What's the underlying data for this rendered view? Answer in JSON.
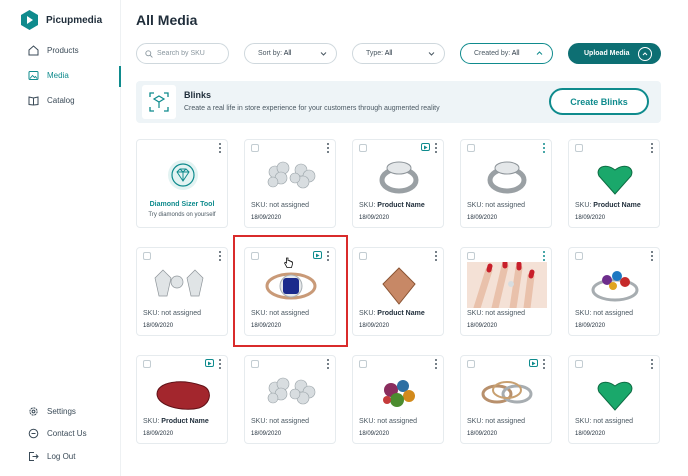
{
  "brand": {
    "name": "Picupmedia"
  },
  "sidebar": {
    "items": [
      {
        "label": "Products",
        "icon": "home-icon"
      },
      {
        "label": "Media",
        "icon": "image-icon"
      },
      {
        "label": "Catalog",
        "icon": "book-icon"
      }
    ],
    "bottom": [
      {
        "label": "Settings",
        "icon": "gear-icon"
      },
      {
        "label": "Contact Us",
        "icon": "chat-icon"
      },
      {
        "label": "Log Out",
        "icon": "logout-icon"
      }
    ]
  },
  "page": {
    "title": "All Media"
  },
  "filters": {
    "search_placeholder": "Search by SKU",
    "sort_label": "Sort by:",
    "sort_value": "All",
    "type_label": "Type:",
    "type_value": "All",
    "created_label": "Created by:",
    "created_value": "All",
    "upload_label": "Upload Media"
  },
  "blinks": {
    "title": "Blinks",
    "description": "Create a real life in store experience for your customers through augmented reality",
    "button": "Create Blinks"
  },
  "tool_card": {
    "title": "Diamond Sizer Tool",
    "subtitle": "Try diamonds on yourself"
  },
  "cards": [
    {
      "sku_label": "SKU:",
      "sku_value": "not assigned",
      "date": "18/09/2020",
      "image": "diamond-earrings",
      "video": false
    },
    {
      "sku_label": "SKU:",
      "sku_value": "Product Name",
      "date": "18/09/2020",
      "image": "silver-ring",
      "video": true
    },
    {
      "sku_label": "SKU:",
      "sku_value": "not assigned",
      "date": "18/09/2020",
      "image": "silver-ring-2",
      "video": false
    },
    {
      "sku_label": "SKU:",
      "sku_value": "Product Name",
      "date": "18/09/2020",
      "image": "green-heart-gem",
      "video": false
    },
    {
      "sku_label": "SKU:",
      "sku_value": "not assigned",
      "date": "18/09/2020",
      "image": "diamond-studs",
      "video": false
    },
    {
      "sku_label": "SKU:",
      "sku_value": "not assigned",
      "date": "18/09/2020",
      "image": "sapphire-ring",
      "video": true
    },
    {
      "sku_label": "SKU:",
      "sku_value": "Product Name",
      "date": "18/09/2020",
      "image": "morganite-gem",
      "video": false
    },
    {
      "sku_label": "SKU:",
      "sku_value": "not assigned",
      "date": "18/09/2020",
      "image": "hand-ring",
      "video": false
    },
    {
      "sku_label": "SKU:",
      "sku_value": "not assigned",
      "date": "18/09/2020",
      "image": "multi-gem-rings",
      "video": false
    },
    {
      "sku_label": "SKU:",
      "sku_value": "Product Name",
      "date": "18/09/2020",
      "image": "red-pear-gem",
      "video": true
    },
    {
      "sku_label": "SKU:",
      "sku_value": "not assigned",
      "date": "18/09/2020",
      "image": "diamond-earrings-2",
      "video": false
    },
    {
      "sku_label": "SKU:",
      "sku_value": "not assigned",
      "date": "18/09/2020",
      "image": "gem-cluster",
      "video": false
    },
    {
      "sku_label": "SKU:",
      "sku_value": "not assigned",
      "date": "18/09/2020",
      "image": "ring-set",
      "video": true
    },
    {
      "sku_label": "SKU:",
      "sku_value": "not assigned",
      "date": "18/09/2020",
      "image": "green-heart-gem-2",
      "video": false
    }
  ],
  "colors": {
    "accent": "#0f8b8d",
    "accent_dark": "#0d6f73",
    "highlight": "#d92b2b"
  }
}
